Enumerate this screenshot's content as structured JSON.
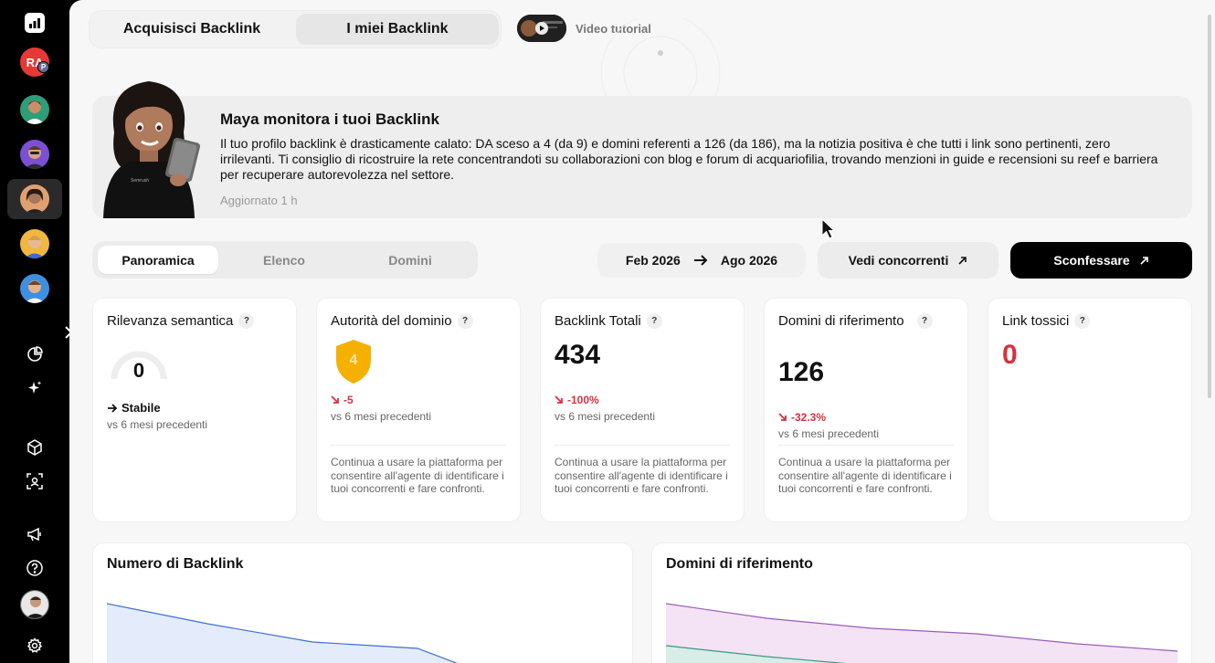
{
  "top_tabs": [
    {
      "label": "Acquisisci Backlink"
    },
    {
      "label": "I miei Backlink"
    }
  ],
  "video": {
    "label": "Video tutorial"
  },
  "maya": {
    "title": "Maya monitora i tuoi Backlink",
    "body": "Il tuo profilo backlink è drasticamente calato: DA sceso a 4 (da 9) e domini referenti a 126 (da 186), ma la notizia positiva è che tutti i link sono pertinenti, zero irrilevanti. Ti consiglio di ricostruire la rete concentrandoti su collaborazioni con blog e forum di acquariofilia, trovando menzioni in guide e recensioni su reef e barriera per recuperare autorevolezza nel settore.",
    "updated": "Aggiornato 1 h"
  },
  "sidebar": {
    "badge_initials": "RA",
    "badge_sub": "P"
  },
  "view_tabs": [
    {
      "label": "Panoramica"
    },
    {
      "label": "Elenco"
    },
    {
      "label": "Domini"
    }
  ],
  "daterange": {
    "from": "Feb 2026",
    "to": "Ago 2026"
  },
  "buttons": {
    "competitors": "Vedi concorrenti",
    "confess": "Sconfessare"
  },
  "cards": {
    "semantic": {
      "title": "Rilevanza semantica",
      "value": "0",
      "trend": "Stabile",
      "vs": "vs 6 mesi precedenti"
    },
    "authority": {
      "title": "Autorità del dominio",
      "value": "4",
      "delta": "-5",
      "vs": "vs 6 mesi precedenti",
      "note": "Continua a usare la piattaforma per consentire all'agente di identificare i tuoi concorrenti e fare confronti."
    },
    "backlinks": {
      "title": "Backlink Totali",
      "value": "434",
      "delta": "-100%",
      "vs": "vs 6 mesi precedenti",
      "note": "Continua a usare la piattaforma per consentire all'agente di identificare i tuoi concorrenti e fare confronti."
    },
    "domains": {
      "title": "Domini di riferimento",
      "value": "126",
      "delta": "-32.3%",
      "vs": "vs 6 mesi precedenti",
      "note": "Continua a usare la piattaforma per consentire all'agente di identificare i tuoi concorrenti e fare confronti."
    },
    "toxic": {
      "title": "Link tossici",
      "value": "0"
    }
  },
  "charts": {
    "backlinks_title": "Numero di Backlink",
    "domains_title": "Domini di riferimento"
  },
  "colors": {
    "accent_dark": "#000000",
    "negative": "#d9303e",
    "shield": "#f5b000",
    "chart_blue": "#dfe8fb",
    "chart_purple": "#f1def3"
  }
}
